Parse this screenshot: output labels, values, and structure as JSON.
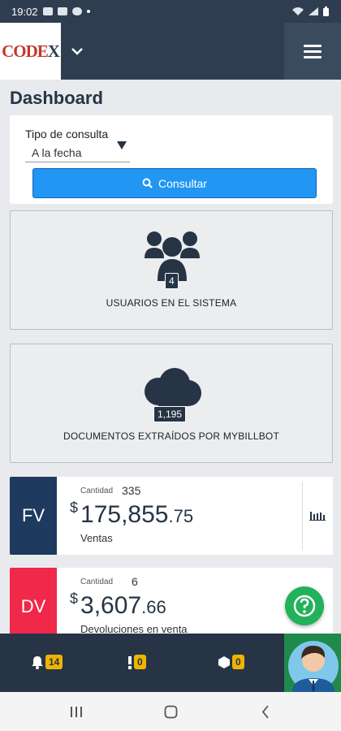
{
  "status": {
    "time": "19:02"
  },
  "logo": {
    "brand_a": "CODE",
    "brand_b": "X"
  },
  "page": {
    "title": "Dashboard"
  },
  "filter": {
    "label": "Tipo de consulta",
    "selected": "A la fecha",
    "button_label": "Consultar"
  },
  "stats": {
    "users": {
      "count": "4",
      "label": "USUARIOS EN EL SISTEMA"
    },
    "documents": {
      "count": "1,195",
      "label": "DOCUMENTOS EXTRAÍDOS POR MYBILLBOT"
    }
  },
  "kpis": [
    {
      "code": "FV",
      "qty_label": "Cantidad",
      "qty": "335",
      "currency": "$",
      "amount_int": "175,855",
      "amount_dec": ".75",
      "name": "Ventas",
      "color": "#1f3a5f"
    },
    {
      "code": "DV",
      "qty_label": "Cantidad",
      "qty": "6",
      "currency": "$",
      "amount_int": "3,607",
      "amount_dec": ".66",
      "name": "Devoluciones en venta",
      "color": "#f0284a"
    }
  ],
  "bottombar": {
    "notifications": "14",
    "alerts": "0",
    "items": "0"
  },
  "colors": {
    "header": "#2e3d50",
    "accent": "#2196f3",
    "badge": "#f0b400",
    "help": "#21b25b"
  }
}
